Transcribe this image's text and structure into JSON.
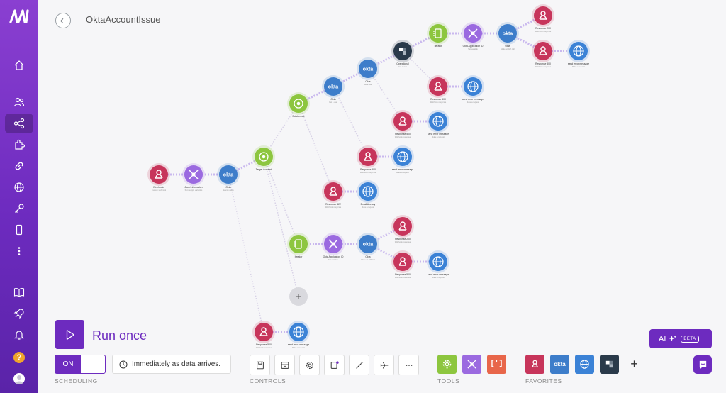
{
  "scenario": {
    "title": "OktaAccountIssue"
  },
  "sidebar": {
    "items": [
      {
        "name": "home-icon"
      },
      {
        "name": "team-icon"
      },
      {
        "name": "scenarios-icon",
        "active": true
      },
      {
        "name": "apps-icon"
      },
      {
        "name": "connections-icon"
      },
      {
        "name": "webhooks-icon"
      },
      {
        "name": "keys-icon"
      },
      {
        "name": "devices-icon"
      },
      {
        "name": "more-icon"
      },
      {
        "name": "docs-icon"
      },
      {
        "name": "rocket-icon"
      },
      {
        "name": "notifications-icon"
      }
    ],
    "help_label": "?"
  },
  "colors": {
    "accent": "#6d2bbf",
    "webhook": "#c7355b",
    "flow": "#9b6ae0",
    "okta": "#3d7dca",
    "router": "#8dc63f",
    "http": "#3b82d6",
    "dark": "#2a3a4a"
  },
  "nodes": [
    {
      "id": "n1",
      "type": "webhook",
      "label": "Webhooks",
      "sub": "Custom webhook"
    },
    {
      "id": "n2",
      "type": "flow",
      "label": "Json Information",
      "sub": "Set multiple variables"
    },
    {
      "id": "n3",
      "type": "okta",
      "label": "Okta",
      "sub": "Search users"
    },
    {
      "id": "n4",
      "type": "router",
      "label": "Target Account",
      "sub": ""
    },
    {
      "id": "n5",
      "type": "router",
      "label": "Exist or not",
      "sub": ""
    },
    {
      "id": "n6",
      "type": "okta",
      "label": "Okta",
      "sub": "Get a user"
    },
    {
      "id": "n7",
      "type": "okta",
      "label": "Okta",
      "sub": "Get a user"
    },
    {
      "id": "n8",
      "type": "dark",
      "label": "Operational",
      "sub": "Get a user"
    },
    {
      "id": "n9",
      "type": "iterator",
      "label": "Iterator",
      "sub": ""
    },
    {
      "id": "n10",
      "type": "flow",
      "label": "Okta Application ID",
      "sub": "Set variable"
    },
    {
      "id": "n11",
      "type": "okta",
      "label": "Okta",
      "sub": "Make an API call"
    },
    {
      "id": "n12",
      "type": "webhook",
      "label": "Response 200",
      "sub": "Webhook response"
    },
    {
      "id": "n13",
      "type": "webhook",
      "label": "Response 500",
      "sub": "Webhook response"
    },
    {
      "id": "n14",
      "type": "http",
      "label": "send error message",
      "sub": "Make a request"
    },
    {
      "id": "n15",
      "type": "webhook",
      "label": "Response 500",
      "sub": "Webhook response"
    },
    {
      "id": "n16",
      "type": "http",
      "label": "send error message",
      "sub": "Make a request"
    },
    {
      "id": "n17",
      "type": "webhook",
      "label": "Response 500",
      "sub": "Webhook response"
    },
    {
      "id": "n18",
      "type": "http",
      "label": "send error message",
      "sub": "Make a request"
    },
    {
      "id": "n19",
      "type": "webhook",
      "label": "Response 500",
      "sub": "Webhook response"
    },
    {
      "id": "n20",
      "type": "http",
      "label": "send error message",
      "sub": "Make a request"
    },
    {
      "id": "n21",
      "type": "webhook",
      "label": "Response 422",
      "sub": "Webhook response"
    },
    {
      "id": "n22",
      "type": "http",
      "label": "Email Already",
      "sub": "Make a request"
    },
    {
      "id": "n23",
      "type": "iterator",
      "label": "Iterator",
      "sub": ""
    },
    {
      "id": "n24",
      "type": "flow",
      "label": "Okta Application ID",
      "sub": "Set variable"
    },
    {
      "id": "n25",
      "type": "okta",
      "label": "Okta",
      "sub": "Make an API call"
    },
    {
      "id": "n26",
      "type": "webhook",
      "label": "Response 200",
      "sub": "Webhook response"
    },
    {
      "id": "n27",
      "type": "webhook",
      "label": "Response 500",
      "sub": "Webhook response"
    },
    {
      "id": "n28",
      "type": "http",
      "label": "send error message",
      "sub": "Make a request"
    },
    {
      "id": "n29",
      "type": "webhook",
      "label": "Response 500",
      "sub": "Webhook response"
    },
    {
      "id": "n30",
      "type": "http",
      "label": "send error message",
      "sub": "Make a request"
    }
  ],
  "edges": [
    [
      "n1",
      "n2"
    ],
    [
      "n2",
      "n3"
    ],
    [
      "n3",
      "n4"
    ],
    [
      "n4",
      "n5"
    ],
    [
      "n5",
      "n6"
    ],
    [
      "n6",
      "n7"
    ],
    [
      "n7",
      "n8"
    ],
    [
      "n8",
      "n9"
    ],
    [
      "n9",
      "n10"
    ],
    [
      "n10",
      "n11"
    ],
    [
      "n11",
      "n12"
    ],
    [
      "n11",
      "n13"
    ],
    [
      "n13",
      "n14"
    ],
    [
      "n8",
      "n15"
    ],
    [
      "n15",
      "n16"
    ],
    [
      "n7",
      "n17"
    ],
    [
      "n17",
      "n18"
    ],
    [
      "n6",
      "n19"
    ],
    [
      "n19",
      "n20"
    ],
    [
      "n5",
      "n21"
    ],
    [
      "n21",
      "n22"
    ],
    [
      "n4",
      "n23"
    ],
    [
      "n23",
      "n24"
    ],
    [
      "n24",
      "n25"
    ],
    [
      "n25",
      "n26"
    ],
    [
      "n25",
      "n27"
    ],
    [
      "n27",
      "n28"
    ],
    [
      "n3",
      "n29"
    ],
    [
      "n29",
      "n30"
    ],
    [
      "n4",
      "add"
    ]
  ],
  "okta_text": "okta",
  "add_module_label": "+",
  "run_once": {
    "label": "Run once"
  },
  "scheduling": {
    "toggle": "ON",
    "text": "Immediately as data arrives.",
    "label": "SCHEDULING"
  },
  "controls": {
    "label": "CONTROLS",
    "buttons": [
      "save-icon",
      "settings-panel-icon",
      "gear-icon",
      "notes-icon",
      "magic-wand-icon",
      "airplane-icon",
      "more-icon"
    ]
  },
  "tools": {
    "label": "TOOLS",
    "buttons": [
      {
        "name": "tools-gear-icon",
        "color": "#8dc63f"
      },
      {
        "name": "flow-control-icon",
        "color": "#9b6ae0"
      },
      {
        "name": "text-parser-icon",
        "color": "#e8664a",
        "glyph": "[']"
      }
    ]
  },
  "favorites": {
    "label": "FAVORITES",
    "buttons": [
      {
        "name": "webhooks-favorite-icon",
        "color": "#c7355b"
      },
      {
        "name": "okta-favorite-icon",
        "color": "#3d7dca",
        "text": "okta"
      },
      {
        "name": "http-favorite-icon",
        "color": "#3b82d6"
      },
      {
        "name": "dark-app-favorite-icon",
        "color": "#2a3a4a"
      }
    ],
    "add": "+"
  },
  "ai": {
    "label": "AI",
    "badge": "BETA"
  }
}
